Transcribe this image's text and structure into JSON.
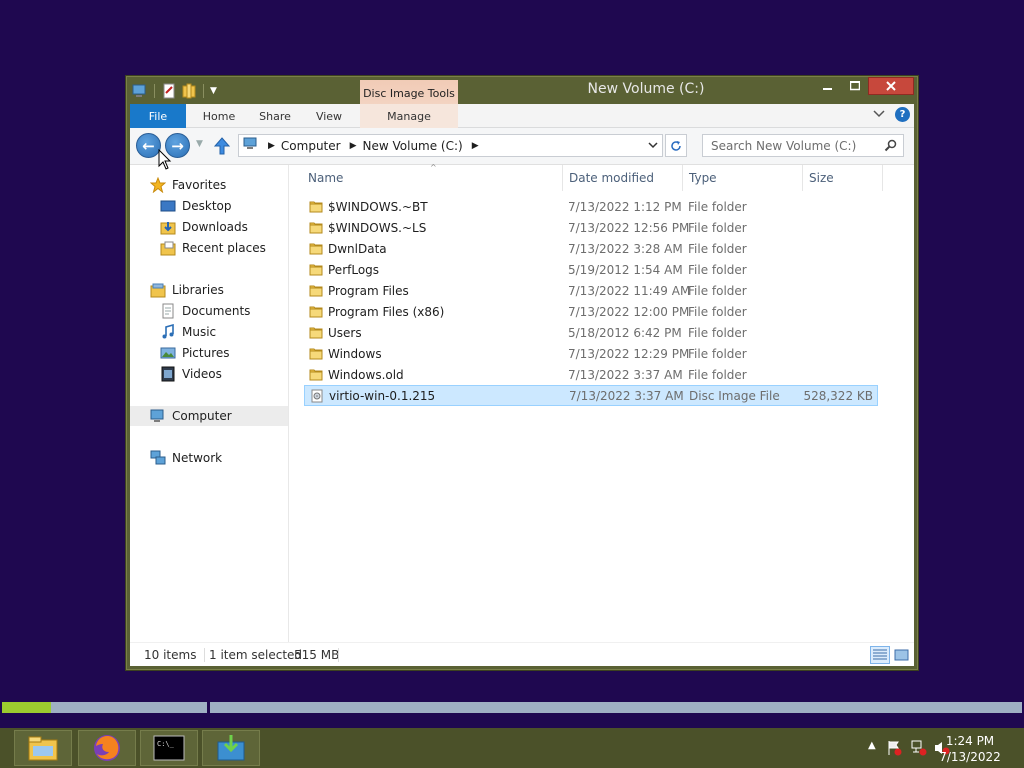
{
  "window": {
    "title": "New Volume (C:)",
    "context_tab_group": "Disc Image Tools",
    "minimize_icon": "minimize-icon",
    "maximize_icon": "maximize-icon",
    "close_icon": "close-icon"
  },
  "ribbon": {
    "tabs": [
      {
        "label": "File",
        "active": true
      },
      {
        "label": "Home"
      },
      {
        "label": "Share"
      },
      {
        "label": "View"
      },
      {
        "label": "Manage"
      }
    ],
    "accent": "#1979ca"
  },
  "address_bar": {
    "segments": [
      "Computer",
      "New Volume (C:)"
    ],
    "search_placeholder": "Search New Volume (C:)"
  },
  "navigation_pane": {
    "favorites": {
      "label": "Favorites",
      "items": [
        "Desktop",
        "Downloads",
        "Recent places"
      ]
    },
    "libraries": {
      "label": "Libraries",
      "items": [
        "Documents",
        "Music",
        "Pictures",
        "Videos"
      ]
    },
    "computer": "Computer",
    "network": "Network"
  },
  "file_list": {
    "columns": [
      "Name",
      "Date modified",
      "Type",
      "Size"
    ],
    "rows": [
      {
        "name": "$WINDOWS.~BT",
        "date": "7/13/2022 1:12 PM",
        "type": "File folder",
        "size": "",
        "icon": "folder-icon"
      },
      {
        "name": "$WINDOWS.~LS",
        "date": "7/13/2022 12:56 PM",
        "type": "File folder",
        "size": "",
        "icon": "folder-icon"
      },
      {
        "name": "DwnlData",
        "date": "7/13/2022 3:28 AM",
        "type": "File folder",
        "size": "",
        "icon": "folder-icon"
      },
      {
        "name": "PerfLogs",
        "date": "5/19/2012 1:54 AM",
        "type": "File folder",
        "size": "",
        "icon": "folder-icon"
      },
      {
        "name": "Program Files",
        "date": "7/13/2022 11:49 AM",
        "type": "File folder",
        "size": "",
        "icon": "folder-icon"
      },
      {
        "name": "Program Files (x86)",
        "date": "7/13/2022 12:00 PM",
        "type": "File folder",
        "size": "",
        "icon": "folder-icon"
      },
      {
        "name": "Users",
        "date": "5/18/2012 6:42 PM",
        "type": "File folder",
        "size": "",
        "icon": "folder-icon"
      },
      {
        "name": "Windows",
        "date": "7/13/2022 12:29 PM",
        "type": "File folder",
        "size": "",
        "icon": "folder-icon"
      },
      {
        "name": "Windows.old",
        "date": "7/13/2022 3:37 AM",
        "type": "File folder",
        "size": "",
        "icon": "folder-icon"
      },
      {
        "name": "virtio-win-0.1.215",
        "date": "7/13/2022 3:37 AM",
        "type": "Disc Image File",
        "size": "528,322 KB",
        "icon": "disc-image-icon",
        "selected": true
      }
    ]
  },
  "status_bar": {
    "item_count": "10 items",
    "selection": "1 item selected",
    "selection_size": "515 MB"
  },
  "progress": {
    "first_bar_fraction": 0.24
  },
  "taskbar": {
    "apps": [
      "file-explorer-icon",
      "firefox-icon",
      "command-prompt-icon",
      "installer-icon"
    ],
    "clock_time": "1:24 PM",
    "clock_date": "7/13/2022"
  },
  "colors": {
    "desktop": "#1f0850",
    "window_frame": "#5a6134",
    "selection": "#cce8ff",
    "close_button": "#c7483c"
  }
}
